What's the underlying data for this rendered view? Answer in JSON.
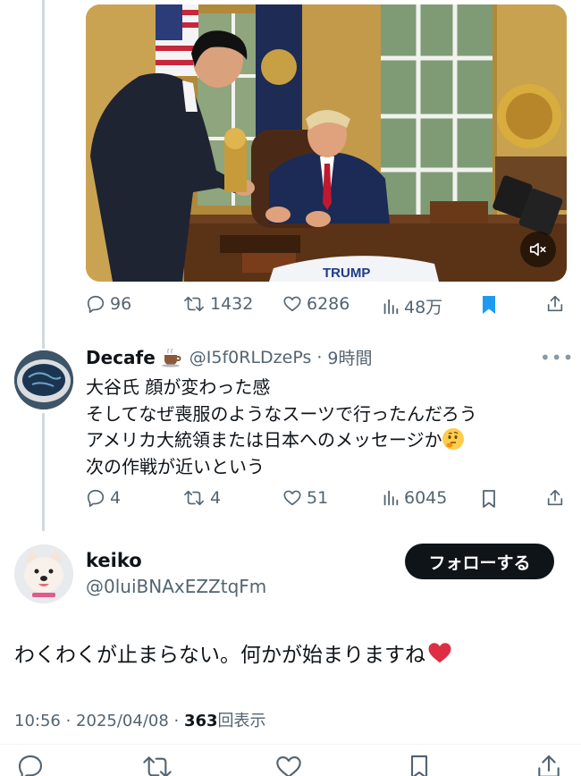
{
  "quoted_tweet": {
    "media_overlay_text": "TRUMP",
    "stats": {
      "replies": "96",
      "retweets": "1432",
      "likes": "6286",
      "views": "48万"
    },
    "bookmarked": true
  },
  "reply": {
    "display_name": "Decafe",
    "name_emoji": "☕",
    "handle": "@I5f0RLDzePs",
    "separator": "·",
    "time": "9時間",
    "more": "•••",
    "lines": [
      "大谷氏 顔が変わった感",
      "そしてなぜ喪服のようなスーツで行ったんだろう",
      "アメリカ大統領または日本へのメッセージか",
      "次の作戦が近いという"
    ],
    "thinking_emoji": "thinking-face",
    "stats": {
      "replies": "4",
      "retweets": "4",
      "likes": "51",
      "views": "6045"
    }
  },
  "main_tweet": {
    "display_name": "keiko",
    "handle": "@0luiBNAxEZZtqFm",
    "follow_label": "フォローする",
    "text": "わくわくが止まらない。何かが始まりますね",
    "heart_emoji": "red-heart",
    "timestamp": "10:56 · 2025/04/08 · ",
    "view_count": "363",
    "view_label": "回表示"
  },
  "colors": {
    "accent": "#1d9bf0",
    "secondary_text": "#536471",
    "primary_text": "#0f1419",
    "follow_bg": "#0f1419",
    "thread_line": "#cfd9de",
    "heart": "#e0245e"
  }
}
